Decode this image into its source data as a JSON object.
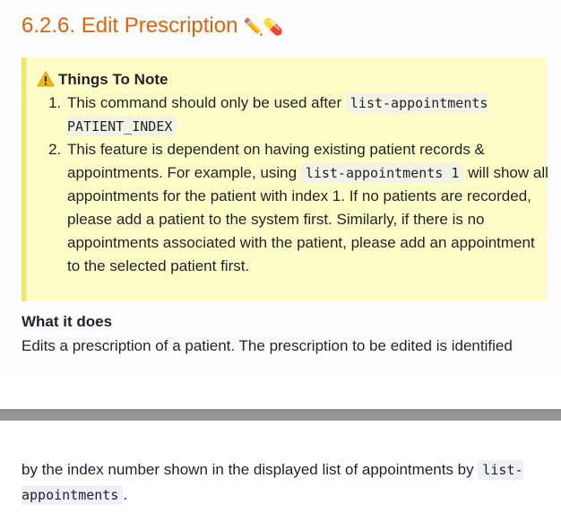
{
  "heading": {
    "text": "6.2.6. Edit Prescription",
    "emoji": "✏️💊"
  },
  "note": {
    "icon": "warning-icon",
    "title": "Things To Note",
    "items": [
      {
        "before": "This command should only be used after ",
        "code": "list-appointments PATIENT_INDEX",
        "after": ""
      },
      {
        "before": "This feature is dependent on having existing patient records & appointments. For example, using ",
        "code": "list-appointments 1",
        "after": " will show all appointments for the patient with index 1. If no patients are recorded, please add a patient to the system first. Similarly, if there is no appointments associated with the patient, please add an appointment to the selected patient first."
      }
    ]
  },
  "section": {
    "title": "What it does",
    "text_top": "Edits a prescription of a patient. The prescription to be edited is identified",
    "text_bottom_before": "by the index number shown in the displayed list of appointments by ",
    "text_bottom_code": "list-appointments",
    "text_bottom_after": "."
  },
  "colors": {
    "heading": "#e36209",
    "note_background": "#fefdc7",
    "note_border": "#f4e463",
    "warning": "#f5b800"
  }
}
